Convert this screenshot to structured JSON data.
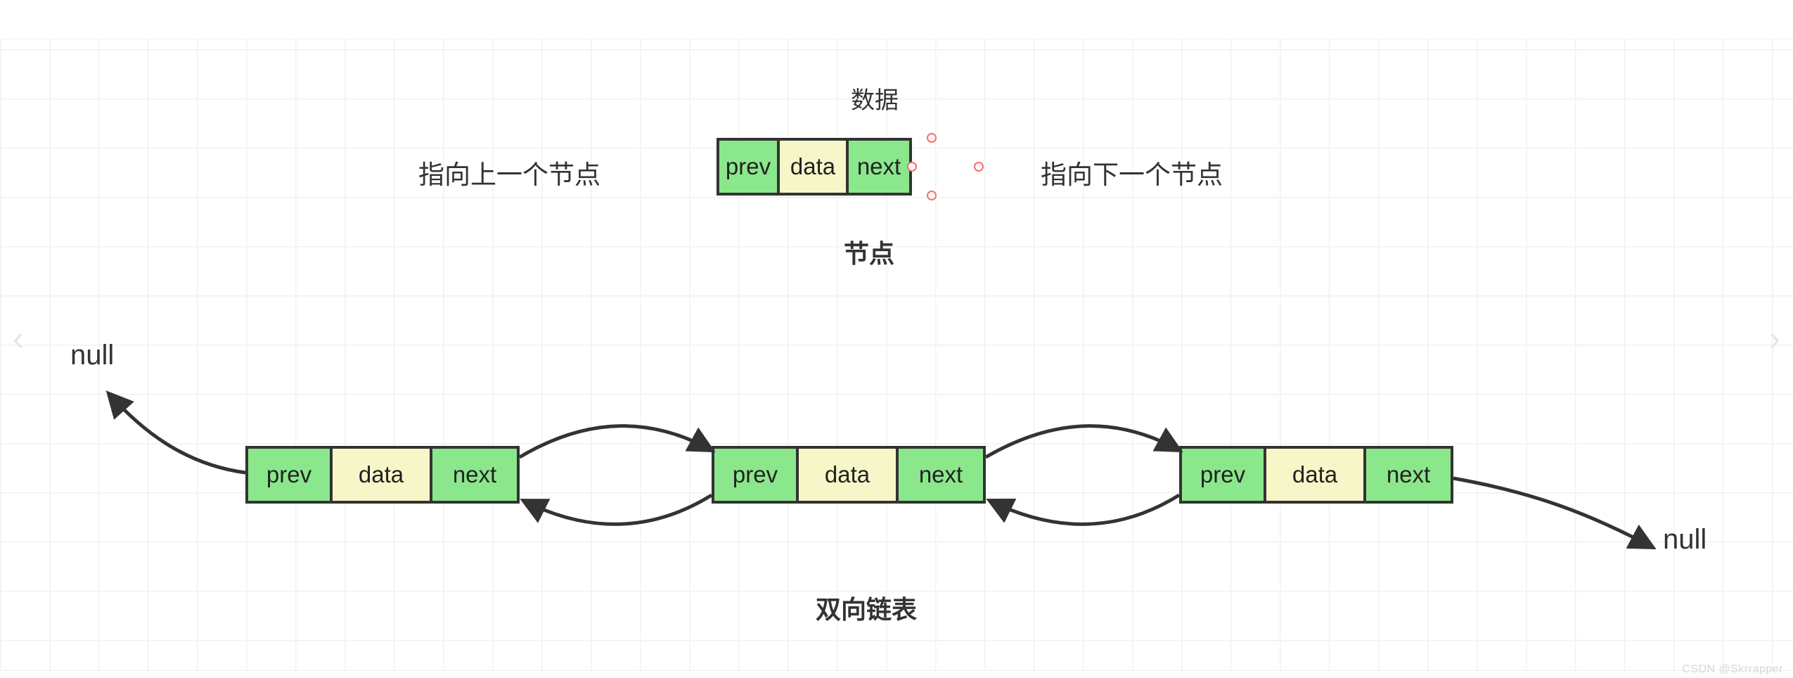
{
  "labels": {
    "data_caption": "数据",
    "point_prev": "指向上一个节点",
    "point_next": "指向下一个节点",
    "node_caption": "节点",
    "list_caption": "双向链表",
    "null_left": "null",
    "null_right": "null"
  },
  "cell_text": {
    "prev": "prev",
    "data": "data",
    "next": "next"
  },
  "watermark": "CSDN @Skrrapper",
  "colors": {
    "green": "#8be78b",
    "cream": "#f6f6c8",
    "border": "#333333",
    "grid": "#f1f1f1"
  },
  "chart_data": {
    "type": "diagram",
    "title": "双向链表",
    "structure": "doubly-linked-list",
    "node_parts": [
      "prev",
      "data",
      "next"
    ],
    "node_part_descriptions": {
      "prev": "指向上一个节点",
      "data": "数据",
      "next": "指向下一个节点"
    },
    "nodes": [
      {
        "id": "n1",
        "prev": "null",
        "next": "n2"
      },
      {
        "id": "n2",
        "prev": "n1",
        "next": "n3"
      },
      {
        "id": "n3",
        "prev": "n2",
        "next": "null"
      }
    ],
    "terminals": {
      "head_prev": "null",
      "tail_next": "null"
    }
  }
}
